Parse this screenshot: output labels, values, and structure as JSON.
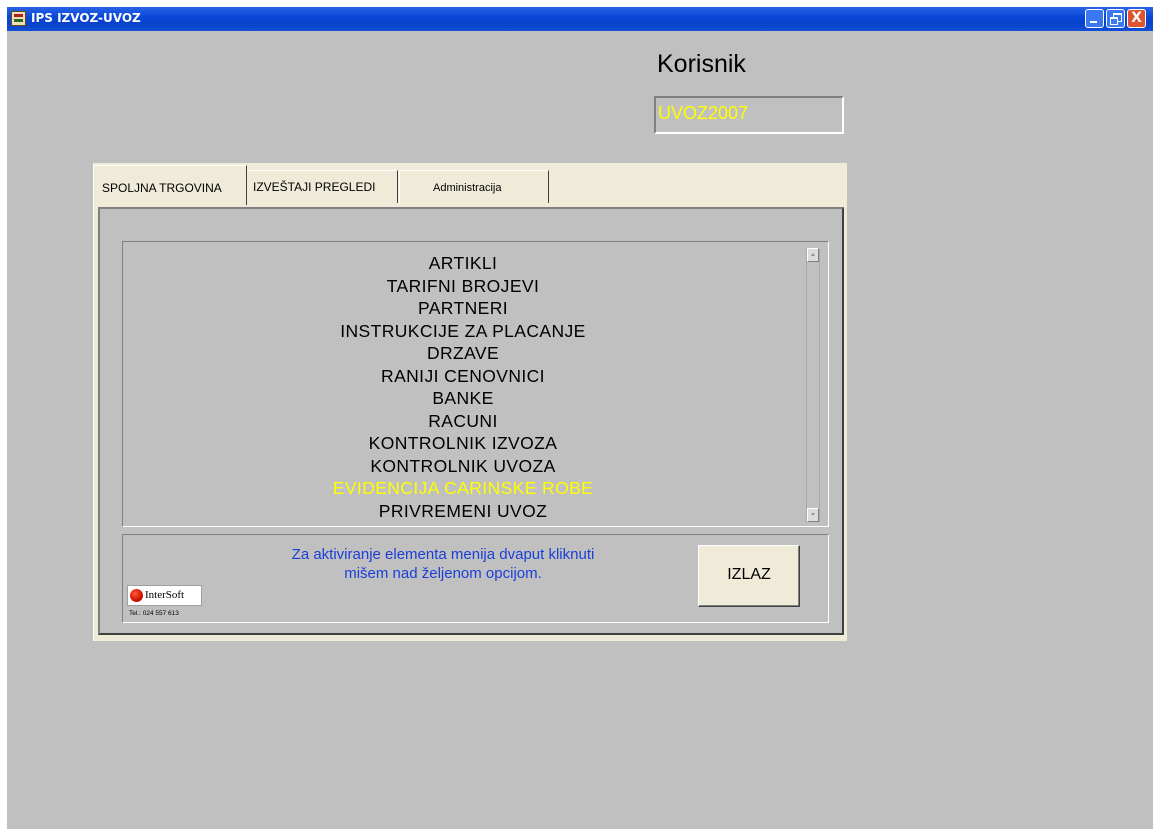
{
  "window": {
    "title": "IPS IZVOZ-UVOZ",
    "controls": {
      "minimize_icon": "minimize-icon",
      "maximize_icon": "restore-icon",
      "close_symbol": "X"
    }
  },
  "user": {
    "label": "Korisnik",
    "value": "UVOZ2007"
  },
  "tabs": [
    {
      "label": "SPOLJNA TRGOVINA",
      "active": true
    },
    {
      "label": "IZVEŠTAJI PREGLEDI",
      "active": false
    },
    {
      "label": "Administracija",
      "active": false
    }
  ],
  "menu": {
    "items": [
      "ARTIKLI",
      "TARIFNI BROJEVI",
      "PARTNERI",
      "INSTRUKCIJE ZA PLACANJE",
      "DRZAVE",
      "RANIJI CENOVNICI",
      "BANKE",
      "RACUNI",
      "KONTROLNIK IZVOZA",
      "KONTROLNIK UVOZA",
      "EVIDENCIJA CARINSKE ROBE",
      "PRIVREMENI UVOZ"
    ],
    "selected": "EVIDENCIJA CARINSKE ROBE"
  },
  "footer": {
    "hint_line1": "Za aktiviranje elementa menija dvaput kliknuti",
    "hint_line2": "mišem nad željenom opcijom.",
    "exit_label": "IZLAZ",
    "logo_text": "InterSoft",
    "phone": "Tel.: 024 557 613"
  },
  "colors": {
    "background": "#c0c0c0",
    "titlebar": "#0a48d8",
    "highlight_text": "#ffff00",
    "hint_text": "#1a3fd8",
    "tab_face": "#efebd8"
  }
}
